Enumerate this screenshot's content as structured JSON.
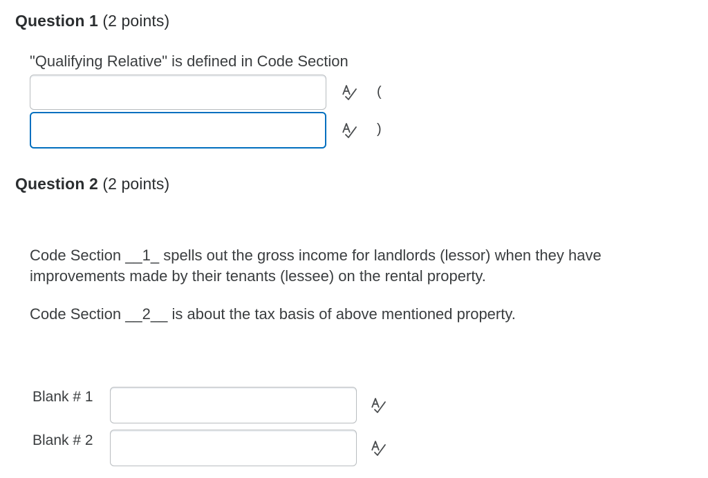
{
  "q1": {
    "title_bold": "Question 1",
    "points": "(2 points)",
    "prompt": "\"Qualifying Relative\" is defined in Code Section",
    "open_paren": "(",
    "close_paren": ")"
  },
  "q2": {
    "title_bold": "Question 2",
    "points": "(2 points)",
    "line1": "Code Section __1_ spells out the gross income for landlords (lessor) when they have",
    "line2": "improvements made by their tenants (lessee) on the rental property.",
    "line3": "Code Section __2__ is about the tax basis of above mentioned property.",
    "blank1_label": "Blank # 1",
    "blank2_label": "Blank # 2"
  },
  "icons": {
    "spellcheck": "spellcheck-icon"
  },
  "colors": {
    "focus_border": "#006fbf",
    "field_border": "#b8bcbf",
    "text": "#3a3d3f"
  }
}
